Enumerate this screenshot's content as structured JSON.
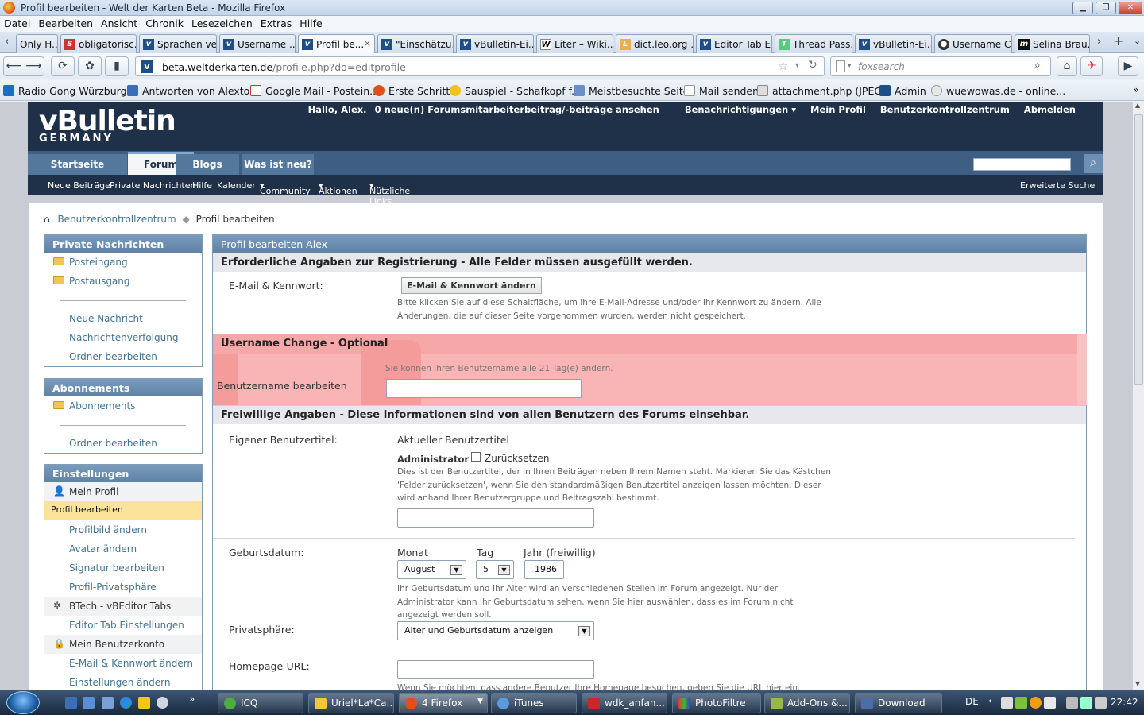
{
  "window": {
    "title": "Profil bearbeiten - Welt der Karten Beta - Mozilla Firefox",
    "min_label": "▁",
    "max_label": "❐",
    "close_label": "✕"
  },
  "menu": [
    "Datei",
    "Bearbeiten",
    "Ansicht",
    "Chronik",
    "Lesezeichen",
    "Extras",
    "Hilfe"
  ],
  "tabs": [
    "Only H...",
    "obligatorisc...",
    "Sprachen ve...",
    "Username ...",
    "Profil be...",
    "\"Einschätzu...",
    "vBulletin-Ei...",
    "Liter – Wiki...",
    "dict.leo.org ...",
    "Editor Tab E...",
    "Thread Pass...",
    "vBulletin-Ei...",
    "Username C...",
    "Selina Brau..."
  ],
  "tab_close": "×",
  "url": {
    "domain": "beta.weltderkarten.de",
    "path": "/profile.php?do=editprofile"
  },
  "search_placeholder": "foxsearch",
  "bookmarks": [
    "Radio Gong Würzburg ...",
    "Antworten von Alexto...",
    "Google Mail - Postein...",
    "Erste Schritte",
    "Sauspiel - Schafkopf f...",
    "Meistbesuchte Seiten",
    "Mail senden",
    "attachment.php (JPEG...",
    "Admin",
    "wuewowas.de - online..."
  ],
  "logo": {
    "main": "vBulletin",
    "sub": "GERMANY"
  },
  "toplinks": {
    "greeting": "Hallo, Alex.",
    "pm": "0 neue(n) Forumsmitarbeiterbeitrag/-beiträge ansehen",
    "notifications": "Benachrichtigungen",
    "profile": "Mein Profil",
    "ucp": "Benutzerkontrollzentrum",
    "logout": "Abmelden"
  },
  "navtabs": [
    "Startseite",
    "Forum",
    "Blogs",
    "Was ist neu?"
  ],
  "subnav": [
    "Neue Beiträge",
    "Private Nachrichten",
    "Hilfe",
    "Kalender",
    "Community",
    "Aktionen",
    "Nützliche Links"
  ],
  "advanced_search": "Erweiterte Suche",
  "breadcrumb": {
    "root": "Benutzerkontrollzentrum",
    "current": "Profil bearbeiten"
  },
  "sidebar": {
    "pm": {
      "title": "Private Nachrichten",
      "items": [
        "Posteingang",
        "Postausgang",
        "Neue Nachricht",
        "Nachrichtenverfolgung",
        "Ordner bearbeiten"
      ]
    },
    "subs": {
      "title": "Abonnements",
      "items": [
        "Abonnements",
        "Ordner bearbeiten"
      ]
    },
    "settings": {
      "title": "Einstellungen",
      "group1": "Mein Profil",
      "items1": [
        "Profil bearbeiten",
        "Profilbild ändern",
        "Avatar ändern",
        "Signatur bearbeiten",
        "Profil-Privatsphäre"
      ],
      "group2": "BTech - vBEditor Tabs",
      "items2": [
        "Editor Tab Einstellungen"
      ],
      "group3": "Mein Benutzerkonto",
      "items3": [
        "E-Mail & Kennwort ändern",
        "Einstellungen ändern"
      ]
    }
  },
  "main": {
    "title": "Profil bearbeiten Alex",
    "sec1": "Erforderliche Angaben zur Registrierung - Alle Felder müssen ausgefüllt werden.",
    "email_label": "E-Mail & Kennwort:",
    "email_button": "E-Mail & Kennwort ändern",
    "email_desc1": "Bitte klicken Sie auf diese Schaltfläche, um Ihre E-Mail-Adresse und/oder Ihr Kennwort zu ändern. Alle",
    "email_desc2": "Änderungen, die auf dieser Seite vorgenommen wurden, werden nicht gespeichert.",
    "sec2": "Username Change - Optional",
    "uname_hint": "Sie können ihren Benutzername alle 21 Tag(e) ändern.",
    "uname_label": "Benutzername bearbeiten",
    "sec3": "Freiwillige Angaben - Diese Informationen sind von allen Benutzern des Forums einsehbar.",
    "title_label": "Eigener Benutzertitel:",
    "title_current_label": "Aktueller Benutzertitel",
    "title_value": "Administrator",
    "reset_label": "Zurücksetzen",
    "title_desc1": "Dies ist der Benutzertitel, der in Ihren Beiträgen neben Ihrem Namen steht. Markieren Sie das Kästchen",
    "title_desc2": "'Felder zurücksetzen', wenn Sie den standardmäßigen Benutzertitel anzeigen lassen möchten. Dieser",
    "title_desc3": "wird anhand Ihrer Benutzergruppe und Beitragszahl bestimmt.",
    "bday_label": "Geburtsdatum:",
    "month_label": "Monat",
    "day_label": "Tag",
    "year_label": "Jahr (freiwillig)",
    "month_value": "August",
    "day_value": "5",
    "year_value": "1986",
    "bday_desc1": "Ihr Geburtsdatum und Ihr Alter wird an verschiedenen Stellen im Forum angezeigt. Nur der",
    "bday_desc2": "Administrator kann Ihr Geburtsdatum sehen, wenn Sie hier auswählen, dass es im Forum nicht",
    "bday_desc3": "angezeigt werden soll.",
    "privacy_label": "Privatsphäre:",
    "privacy_value": "Alter und Geburtsdatum anzeigen",
    "homepage_label": "Homepage-URL:",
    "homepage_desc": "Wenn Sie möchten, dass andere Benutzer Ihre Homepage besuchen, geben Sie die URL hier ein."
  },
  "taskbar": {
    "buttons": [
      "ICQ",
      "Uriel*La*Ca...",
      "4 Firefox",
      "iTunes",
      "wdk_anfan...",
      "PhotoFiltre",
      "Add-Ons &...",
      "Download"
    ],
    "lang": "DE",
    "clock": "22:42"
  },
  "colors": {
    "highlight": "#f9b5b5",
    "header": "#1e3148",
    "link": "#417394",
    "selected": "#fbe39b"
  }
}
